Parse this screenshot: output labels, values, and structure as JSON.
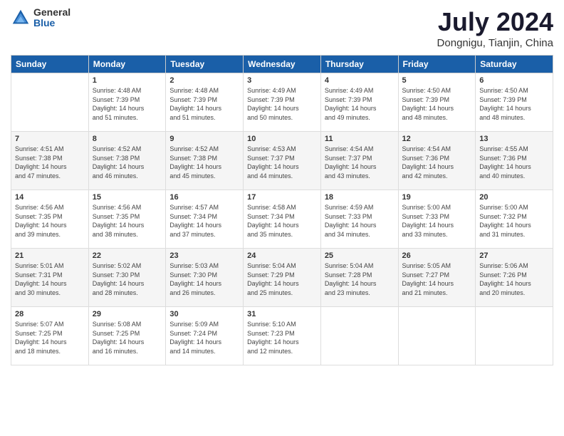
{
  "header": {
    "logo_general": "General",
    "logo_blue": "Blue",
    "title": "July 2024",
    "subtitle": "Dongnigu, Tianjin, China"
  },
  "days_of_week": [
    "Sunday",
    "Monday",
    "Tuesday",
    "Wednesday",
    "Thursday",
    "Friday",
    "Saturday"
  ],
  "weeks": [
    [
      {
        "day": "",
        "info": ""
      },
      {
        "day": "1",
        "info": "Sunrise: 4:48 AM\nSunset: 7:39 PM\nDaylight: 14 hours\nand 51 minutes."
      },
      {
        "day": "2",
        "info": "Sunrise: 4:48 AM\nSunset: 7:39 PM\nDaylight: 14 hours\nand 51 minutes."
      },
      {
        "day": "3",
        "info": "Sunrise: 4:49 AM\nSunset: 7:39 PM\nDaylight: 14 hours\nand 50 minutes."
      },
      {
        "day": "4",
        "info": "Sunrise: 4:49 AM\nSunset: 7:39 PM\nDaylight: 14 hours\nand 49 minutes."
      },
      {
        "day": "5",
        "info": "Sunrise: 4:50 AM\nSunset: 7:39 PM\nDaylight: 14 hours\nand 48 minutes."
      },
      {
        "day": "6",
        "info": "Sunrise: 4:50 AM\nSunset: 7:39 PM\nDaylight: 14 hours\nand 48 minutes."
      }
    ],
    [
      {
        "day": "7",
        "info": "Sunrise: 4:51 AM\nSunset: 7:38 PM\nDaylight: 14 hours\nand 47 minutes."
      },
      {
        "day": "8",
        "info": "Sunrise: 4:52 AM\nSunset: 7:38 PM\nDaylight: 14 hours\nand 46 minutes."
      },
      {
        "day": "9",
        "info": "Sunrise: 4:52 AM\nSunset: 7:38 PM\nDaylight: 14 hours\nand 45 minutes."
      },
      {
        "day": "10",
        "info": "Sunrise: 4:53 AM\nSunset: 7:37 PM\nDaylight: 14 hours\nand 44 minutes."
      },
      {
        "day": "11",
        "info": "Sunrise: 4:54 AM\nSunset: 7:37 PM\nDaylight: 14 hours\nand 43 minutes."
      },
      {
        "day": "12",
        "info": "Sunrise: 4:54 AM\nSunset: 7:36 PM\nDaylight: 14 hours\nand 42 minutes."
      },
      {
        "day": "13",
        "info": "Sunrise: 4:55 AM\nSunset: 7:36 PM\nDaylight: 14 hours\nand 40 minutes."
      }
    ],
    [
      {
        "day": "14",
        "info": "Sunrise: 4:56 AM\nSunset: 7:35 PM\nDaylight: 14 hours\nand 39 minutes."
      },
      {
        "day": "15",
        "info": "Sunrise: 4:56 AM\nSunset: 7:35 PM\nDaylight: 14 hours\nand 38 minutes."
      },
      {
        "day": "16",
        "info": "Sunrise: 4:57 AM\nSunset: 7:34 PM\nDaylight: 14 hours\nand 37 minutes."
      },
      {
        "day": "17",
        "info": "Sunrise: 4:58 AM\nSunset: 7:34 PM\nDaylight: 14 hours\nand 35 minutes."
      },
      {
        "day": "18",
        "info": "Sunrise: 4:59 AM\nSunset: 7:33 PM\nDaylight: 14 hours\nand 34 minutes."
      },
      {
        "day": "19",
        "info": "Sunrise: 5:00 AM\nSunset: 7:33 PM\nDaylight: 14 hours\nand 33 minutes."
      },
      {
        "day": "20",
        "info": "Sunrise: 5:00 AM\nSunset: 7:32 PM\nDaylight: 14 hours\nand 31 minutes."
      }
    ],
    [
      {
        "day": "21",
        "info": "Sunrise: 5:01 AM\nSunset: 7:31 PM\nDaylight: 14 hours\nand 30 minutes."
      },
      {
        "day": "22",
        "info": "Sunrise: 5:02 AM\nSunset: 7:30 PM\nDaylight: 14 hours\nand 28 minutes."
      },
      {
        "day": "23",
        "info": "Sunrise: 5:03 AM\nSunset: 7:30 PM\nDaylight: 14 hours\nand 26 minutes."
      },
      {
        "day": "24",
        "info": "Sunrise: 5:04 AM\nSunset: 7:29 PM\nDaylight: 14 hours\nand 25 minutes."
      },
      {
        "day": "25",
        "info": "Sunrise: 5:04 AM\nSunset: 7:28 PM\nDaylight: 14 hours\nand 23 minutes."
      },
      {
        "day": "26",
        "info": "Sunrise: 5:05 AM\nSunset: 7:27 PM\nDaylight: 14 hours\nand 21 minutes."
      },
      {
        "day": "27",
        "info": "Sunrise: 5:06 AM\nSunset: 7:26 PM\nDaylight: 14 hours\nand 20 minutes."
      }
    ],
    [
      {
        "day": "28",
        "info": "Sunrise: 5:07 AM\nSunset: 7:25 PM\nDaylight: 14 hours\nand 18 minutes."
      },
      {
        "day": "29",
        "info": "Sunrise: 5:08 AM\nSunset: 7:25 PM\nDaylight: 14 hours\nand 16 minutes."
      },
      {
        "day": "30",
        "info": "Sunrise: 5:09 AM\nSunset: 7:24 PM\nDaylight: 14 hours\nand 14 minutes."
      },
      {
        "day": "31",
        "info": "Sunrise: 5:10 AM\nSunset: 7:23 PM\nDaylight: 14 hours\nand 12 minutes."
      },
      {
        "day": "",
        "info": ""
      },
      {
        "day": "",
        "info": ""
      },
      {
        "day": "",
        "info": ""
      }
    ]
  ]
}
